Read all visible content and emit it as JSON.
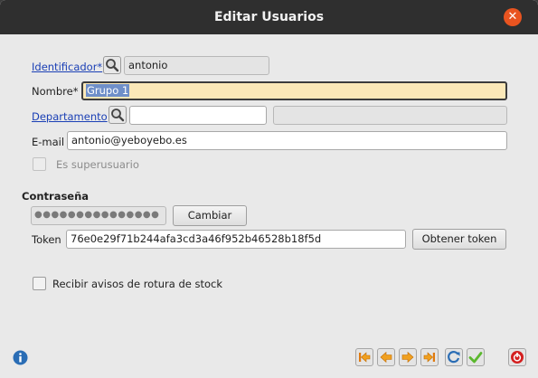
{
  "window": {
    "title": "Editar Usuarios"
  },
  "form": {
    "identificador": {
      "label": "Identificador*",
      "value": "antonio"
    },
    "nombre": {
      "label": "Nombre*",
      "value": "Grupo 1"
    },
    "departamento": {
      "label": "Departamento",
      "value": "",
      "description": ""
    },
    "email": {
      "label": "E-mail",
      "value": "antonio@yeboyebo.es"
    },
    "superusuario": {
      "label": "Es superusuario",
      "checked": false,
      "enabled": false
    },
    "password_section": {
      "title": "Contraseña",
      "masked_value": "●●●●●●●●●●●●●●●",
      "change_button": "Cambiar"
    },
    "token": {
      "label": "Token",
      "value": "76e0e29f71b244afa3cd3a46f952b46528b18f5d",
      "get_button": "Obtener token"
    },
    "stock_alert": {
      "label": "Recibir avisos de rotura de stock",
      "checked": false
    }
  },
  "toolbar": {
    "info": "info-icon",
    "nav_buttons": [
      "first-record-icon",
      "previous-record-icon",
      "next-record-icon",
      "last-record-icon",
      "refresh-icon",
      "accept-icon"
    ],
    "close": "close-form-icon"
  },
  "colors": {
    "title_bar": "#2f2f2f",
    "close_button": "#e95420",
    "link": "#1a3fb5",
    "focused_field": "#fbe8b8",
    "selection": "#6f8fc9",
    "nav_arrow": "#f0a020",
    "accept_check": "#5bb82e",
    "exit_button": "#d42020"
  }
}
